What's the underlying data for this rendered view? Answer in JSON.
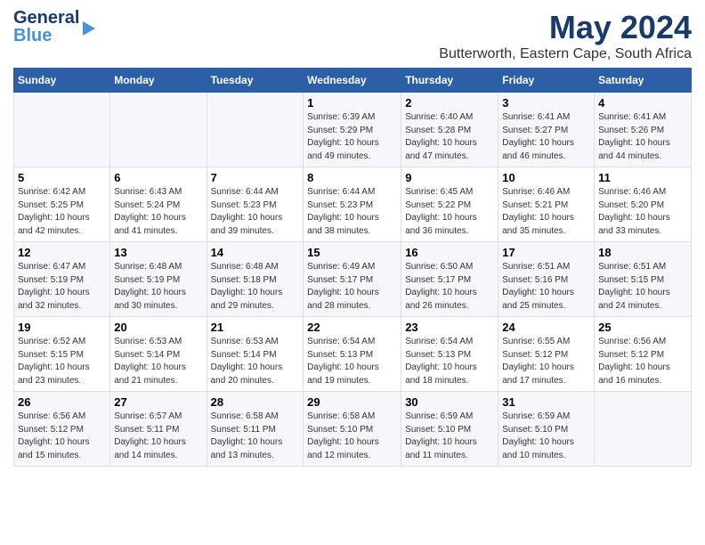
{
  "header": {
    "logo_general": "General",
    "logo_blue": "Blue",
    "month_title": "May 2024",
    "location": "Butterworth, Eastern Cape, South Africa"
  },
  "days_of_week": [
    "Sunday",
    "Monday",
    "Tuesday",
    "Wednesday",
    "Thursday",
    "Friday",
    "Saturday"
  ],
  "weeks": [
    [
      {
        "num": "",
        "info": ""
      },
      {
        "num": "",
        "info": ""
      },
      {
        "num": "",
        "info": ""
      },
      {
        "num": "1",
        "info": "Sunrise: 6:39 AM\nSunset: 5:29 PM\nDaylight: 10 hours\nand 49 minutes."
      },
      {
        "num": "2",
        "info": "Sunrise: 6:40 AM\nSunset: 5:28 PM\nDaylight: 10 hours\nand 47 minutes."
      },
      {
        "num": "3",
        "info": "Sunrise: 6:41 AM\nSunset: 5:27 PM\nDaylight: 10 hours\nand 46 minutes."
      },
      {
        "num": "4",
        "info": "Sunrise: 6:41 AM\nSunset: 5:26 PM\nDaylight: 10 hours\nand 44 minutes."
      }
    ],
    [
      {
        "num": "5",
        "info": "Sunrise: 6:42 AM\nSunset: 5:25 PM\nDaylight: 10 hours\nand 42 minutes."
      },
      {
        "num": "6",
        "info": "Sunrise: 6:43 AM\nSunset: 5:24 PM\nDaylight: 10 hours\nand 41 minutes."
      },
      {
        "num": "7",
        "info": "Sunrise: 6:44 AM\nSunset: 5:23 PM\nDaylight: 10 hours\nand 39 minutes."
      },
      {
        "num": "8",
        "info": "Sunrise: 6:44 AM\nSunset: 5:23 PM\nDaylight: 10 hours\nand 38 minutes."
      },
      {
        "num": "9",
        "info": "Sunrise: 6:45 AM\nSunset: 5:22 PM\nDaylight: 10 hours\nand 36 minutes."
      },
      {
        "num": "10",
        "info": "Sunrise: 6:46 AM\nSunset: 5:21 PM\nDaylight: 10 hours\nand 35 minutes."
      },
      {
        "num": "11",
        "info": "Sunrise: 6:46 AM\nSunset: 5:20 PM\nDaylight: 10 hours\nand 33 minutes."
      }
    ],
    [
      {
        "num": "12",
        "info": "Sunrise: 6:47 AM\nSunset: 5:19 PM\nDaylight: 10 hours\nand 32 minutes."
      },
      {
        "num": "13",
        "info": "Sunrise: 6:48 AM\nSunset: 5:19 PM\nDaylight: 10 hours\nand 30 minutes."
      },
      {
        "num": "14",
        "info": "Sunrise: 6:48 AM\nSunset: 5:18 PM\nDaylight: 10 hours\nand 29 minutes."
      },
      {
        "num": "15",
        "info": "Sunrise: 6:49 AM\nSunset: 5:17 PM\nDaylight: 10 hours\nand 28 minutes."
      },
      {
        "num": "16",
        "info": "Sunrise: 6:50 AM\nSunset: 5:17 PM\nDaylight: 10 hours\nand 26 minutes."
      },
      {
        "num": "17",
        "info": "Sunrise: 6:51 AM\nSunset: 5:16 PM\nDaylight: 10 hours\nand 25 minutes."
      },
      {
        "num": "18",
        "info": "Sunrise: 6:51 AM\nSunset: 5:15 PM\nDaylight: 10 hours\nand 24 minutes."
      }
    ],
    [
      {
        "num": "19",
        "info": "Sunrise: 6:52 AM\nSunset: 5:15 PM\nDaylight: 10 hours\nand 23 minutes."
      },
      {
        "num": "20",
        "info": "Sunrise: 6:53 AM\nSunset: 5:14 PM\nDaylight: 10 hours\nand 21 minutes."
      },
      {
        "num": "21",
        "info": "Sunrise: 6:53 AM\nSunset: 5:14 PM\nDaylight: 10 hours\nand 20 minutes."
      },
      {
        "num": "22",
        "info": "Sunrise: 6:54 AM\nSunset: 5:13 PM\nDaylight: 10 hours\nand 19 minutes."
      },
      {
        "num": "23",
        "info": "Sunrise: 6:54 AM\nSunset: 5:13 PM\nDaylight: 10 hours\nand 18 minutes."
      },
      {
        "num": "24",
        "info": "Sunrise: 6:55 AM\nSunset: 5:12 PM\nDaylight: 10 hours\nand 17 minutes."
      },
      {
        "num": "25",
        "info": "Sunrise: 6:56 AM\nSunset: 5:12 PM\nDaylight: 10 hours\nand 16 minutes."
      }
    ],
    [
      {
        "num": "26",
        "info": "Sunrise: 6:56 AM\nSunset: 5:12 PM\nDaylight: 10 hours\nand 15 minutes."
      },
      {
        "num": "27",
        "info": "Sunrise: 6:57 AM\nSunset: 5:11 PM\nDaylight: 10 hours\nand 14 minutes."
      },
      {
        "num": "28",
        "info": "Sunrise: 6:58 AM\nSunset: 5:11 PM\nDaylight: 10 hours\nand 13 minutes."
      },
      {
        "num": "29",
        "info": "Sunrise: 6:58 AM\nSunset: 5:10 PM\nDaylight: 10 hours\nand 12 minutes."
      },
      {
        "num": "30",
        "info": "Sunrise: 6:59 AM\nSunset: 5:10 PM\nDaylight: 10 hours\nand 11 minutes."
      },
      {
        "num": "31",
        "info": "Sunrise: 6:59 AM\nSunset: 5:10 PM\nDaylight: 10 hours\nand 10 minutes."
      },
      {
        "num": "",
        "info": ""
      }
    ]
  ]
}
